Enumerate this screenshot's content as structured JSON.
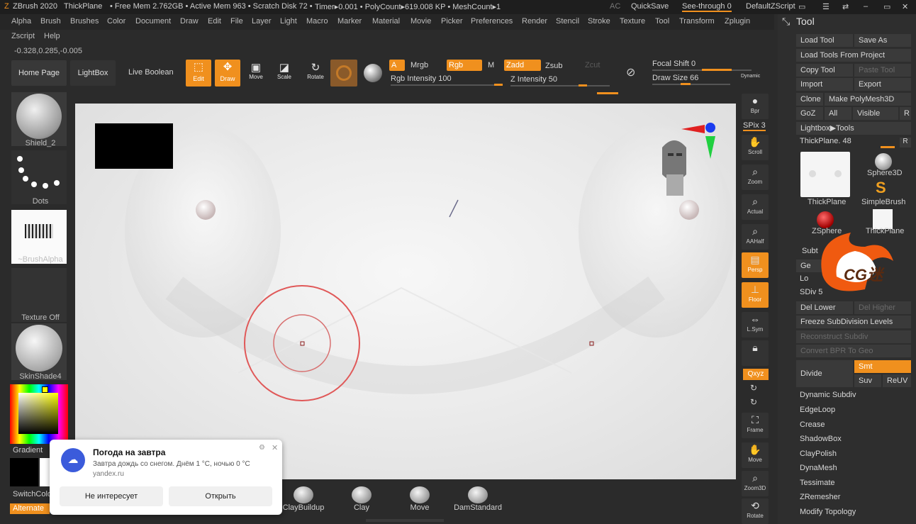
{
  "titlebar": {
    "app": "ZBrush 2020",
    "doc": "ThickPlane",
    "free_mem": "• Free Mem 2.762GB • Active Mem 963 • Scratch Disk 72 •",
    "timer": "Timer▸0.001 • PolyCount▸619.008 KP • MeshCount▸1",
    "ac": "AC",
    "quicksave": "QuickSave",
    "see_through": "See-through  0",
    "default_zscript": "DefaultZScript"
  },
  "menu": [
    "Alpha",
    "Brush",
    "Brushes",
    "Color",
    "Document",
    "Draw",
    "Edit",
    "File",
    "Layer",
    "Light",
    "Macro",
    "Marker",
    "Material",
    "Movie",
    "Picker",
    "Preferences",
    "Render",
    "Stencil",
    "Stroke",
    "Texture",
    "Tool",
    "Transform",
    "Zplugin"
  ],
  "menu2": [
    "Zscript",
    "Help"
  ],
  "coords": "-0.328,0.285,-0.005",
  "toolbar": {
    "home": "Home Page",
    "lightbox": "LightBox",
    "live_boolean": "Live Boolean",
    "edit": "Edit",
    "draw": "Draw",
    "move": "Move",
    "scale": "Scale",
    "rotate": "Rotate",
    "a": "A",
    "mrgb": "Mrgb",
    "rgb": "Rgb",
    "m": "M",
    "zadd": "Zadd",
    "zsub": "Zsub",
    "zcut": "Zcut",
    "rgb_intensity": "Rgb Intensity 100",
    "z_intensity": "Z Intensity 50",
    "focal_shift": "Focal Shift 0",
    "draw_size": "Draw Size 66",
    "dynamic": "Dynamic"
  },
  "leftshelf": {
    "shield": "Shield_2",
    "dots": "Dots",
    "brushalpha": "~BrushAlpha",
    "texture": "Texture Off",
    "skinshade": "SkinShade4",
    "gradient": "Gradient",
    "switchcolor": "SwitchColo",
    "alternate": "Alternate"
  },
  "rightshelf": [
    "Bpr",
    "SPix 3",
    "Scroll",
    "Zoom",
    "Actual",
    "AAHalf",
    "Persp",
    "Floor",
    "L.Sym",
    "",
    "Qxyz",
    "",
    "",
    "Frame",
    "Move",
    "Zoom3D",
    "Rotate"
  ],
  "toolpanel": {
    "title": "Tool",
    "load_tool": "Load Tool",
    "save_as": "Save As",
    "load_from_project": "Load Tools From Project",
    "copy_tool": "Copy Tool",
    "paste_tool": "Paste Tool",
    "import": "Import",
    "export": "Export",
    "clone": "Clone",
    "make_polymesh": "Make PolyMesh3D",
    "goz": "GoZ",
    "all": "All",
    "visible": "Visible",
    "r": "R",
    "lightbox_tools": "Lightbox▶Tools",
    "thickplane_slider": "ThickPlane. 48",
    "thumb1": "ThickPlane",
    "thumb2": "Sphere3D",
    "thumb3": "SimpleBrush",
    "thumb4": "ZSphere",
    "thumb5": "ThickPlane",
    "subtool": "Subt",
    "geometry": "Ge",
    "lower": "Lo",
    "sdiv": "SDiv 5",
    "del_lower": "Del Lower",
    "del_higher": "Del Higher",
    "freeze": "Freeze SubDivision Levels",
    "reconstruct": "Reconstruct Subdiv",
    "convert_bpr": "Convert BPR To Geo",
    "divide": "Divide",
    "smt": "Smt",
    "suv": "Suv",
    "reuv": "ReUV",
    "items": [
      "Dynamic Subdiv",
      "EdgeLoop",
      "Crease",
      "ShadowBox",
      "ClayPolish",
      "DynaMesh",
      "Tessimate",
      "ZRemesher",
      "Modify Topology"
    ]
  },
  "brushes": [
    "ClayBuildup",
    "Clay",
    "Move",
    "DamStandard"
  ],
  "notification": {
    "title": "Погода на завтра",
    "body": "Завтра дождь со снегом. Днём 1 °C, ночью 0 °C",
    "source": "yandex.ru",
    "dismiss": "Не интересует",
    "open": "Открыть"
  },
  "watermark": "CG迷",
  "colors": {
    "accent": "#f0901e",
    "bg": "#2b2b2b",
    "viewport": "#ececec"
  }
}
